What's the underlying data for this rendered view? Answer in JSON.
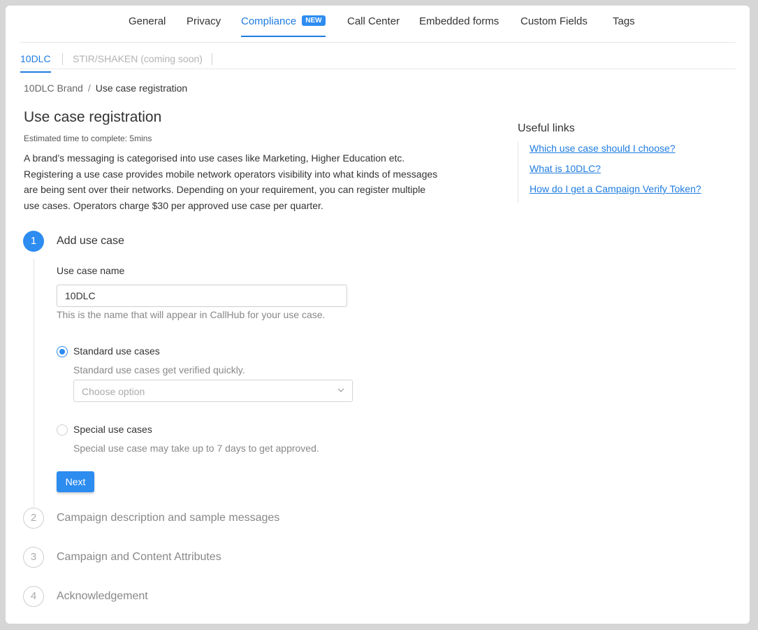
{
  "top_nav": {
    "tabs": [
      {
        "label": "General"
      },
      {
        "label": "Privacy"
      },
      {
        "label": "Compliance",
        "badge": "NEW",
        "active": true
      },
      {
        "label": "Call Center"
      },
      {
        "label": "Embedded forms"
      },
      {
        "label": "Custom Fields"
      },
      {
        "label": "Tags"
      }
    ]
  },
  "sub_nav": {
    "tabs": [
      {
        "label": "10DLC",
        "active": true
      },
      {
        "label": "STIR/SHAKEN (coming soon)",
        "disabled": true
      }
    ]
  },
  "breadcrumb": {
    "parent": "10DLC Brand",
    "separator": "/",
    "current": "Use case registration"
  },
  "page": {
    "title": "Use case registration",
    "estimated_time": "Estimated time to complete: 5mins",
    "description": "A brand’s messaging is categorised into use cases like Marketing, Higher Education etc. Registering a use case provides mobile network operators visibility into what kinds of messages are being sent over their networks. Depending on your requirement, you can register multiple use cases. Operators charge $30 per approved use case per quarter."
  },
  "steps": [
    {
      "number": "1",
      "title": "Add use case",
      "active": true
    },
    {
      "number": "2",
      "title": "Campaign description and sample messages"
    },
    {
      "number": "3",
      "title": "Campaign and Content Attributes"
    },
    {
      "number": "4",
      "title": "Acknowledgement"
    }
  ],
  "form": {
    "use_case_name": {
      "label": "Use case name",
      "value": "10DLC",
      "help": "This is the name that will appear in CallHub for your use case."
    },
    "standard": {
      "label": "Standard use cases",
      "help": "Standard use cases get verified quickly.",
      "checked": true,
      "select_placeholder": "Choose option"
    },
    "special": {
      "label": "Special use cases",
      "help": "Special use case may take up to 7 days to get approved.",
      "checked": false
    },
    "next_label": "Next"
  },
  "useful_links": {
    "title": "Useful links",
    "items": [
      {
        "label": "Which use case should I choose?"
      },
      {
        "label": "What is 10DLC?"
      },
      {
        "label": "How do I get a Campaign Verify Token?"
      }
    ]
  },
  "colors": {
    "accent": "#2d8cf0",
    "link": "#1f7ce0"
  }
}
